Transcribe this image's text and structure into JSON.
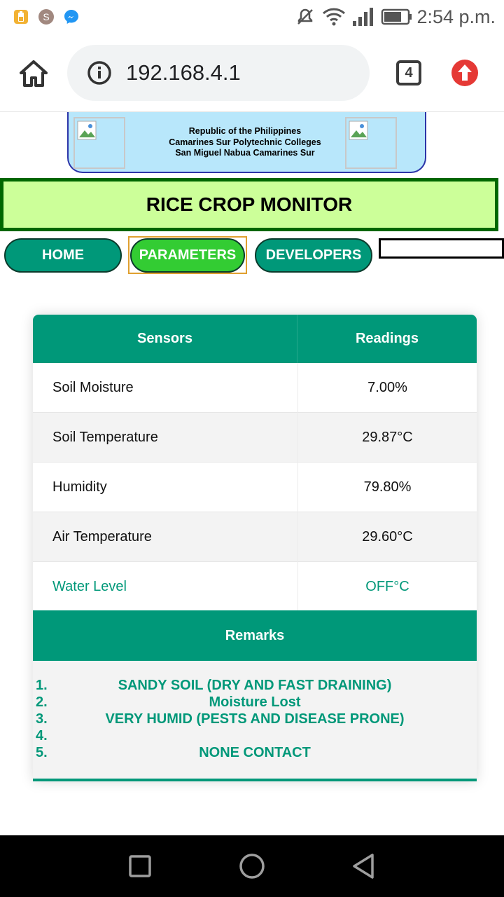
{
  "status_bar": {
    "clock": "2:54 p.m.",
    "notifications": [
      {
        "icon": "battery-saver-notification-icon",
        "letter": ""
      },
      {
        "icon": "account-s-notification-icon",
        "letter": "S"
      },
      {
        "icon": "messenger-icon",
        "letter": ""
      }
    ],
    "system_icons": [
      "mute-icon",
      "wifi-icon",
      "signal-icon",
      "battery-icon"
    ]
  },
  "browser": {
    "url": "192.168.4.1",
    "tab_count": "4"
  },
  "page": {
    "school_header": [
      "Republic of the Philippines",
      "Camarines Sur Polytechnic Colleges",
      "San Miguel Nabua Camarines Sur"
    ],
    "title": "RICE CROP MONITOR",
    "nav": {
      "home": "HOME",
      "parameters": "PARAMETERS",
      "developers": "DEVELOPERS"
    },
    "table": {
      "headers": {
        "sensors": "Sensors",
        "readings": "Readings"
      },
      "rows": [
        {
          "sensor": "Soil Moisture",
          "reading": "7.00%"
        },
        {
          "sensor": "Soil Temperature",
          "reading": "29.87°C"
        },
        {
          "sensor": "Humidity",
          "reading": "79.80%"
        },
        {
          "sensor": "Air Temperature",
          "reading": "29.60°C"
        },
        {
          "sensor": "Water Level",
          "reading": "OFF°C"
        }
      ],
      "remarks_header": "Remarks",
      "remarks": [
        {
          "num": "1.",
          "text": "SANDY SOIL (DRY AND FAST DRAINING)"
        },
        {
          "num": "2.",
          "text": "Moisture Lost"
        },
        {
          "num": "3.",
          "text": "VERY HUMID (PESTS AND DISEASE PRONE)"
        },
        {
          "num": "4.",
          "text": ""
        },
        {
          "num": "5.",
          "text": "NONE CONTACT"
        }
      ]
    }
  },
  "colors": {
    "accent": "#009879",
    "active_nav": "#33cc33",
    "title_bg": "#ccff99",
    "title_border": "#006600",
    "header_bg": "#b8e7fb"
  }
}
